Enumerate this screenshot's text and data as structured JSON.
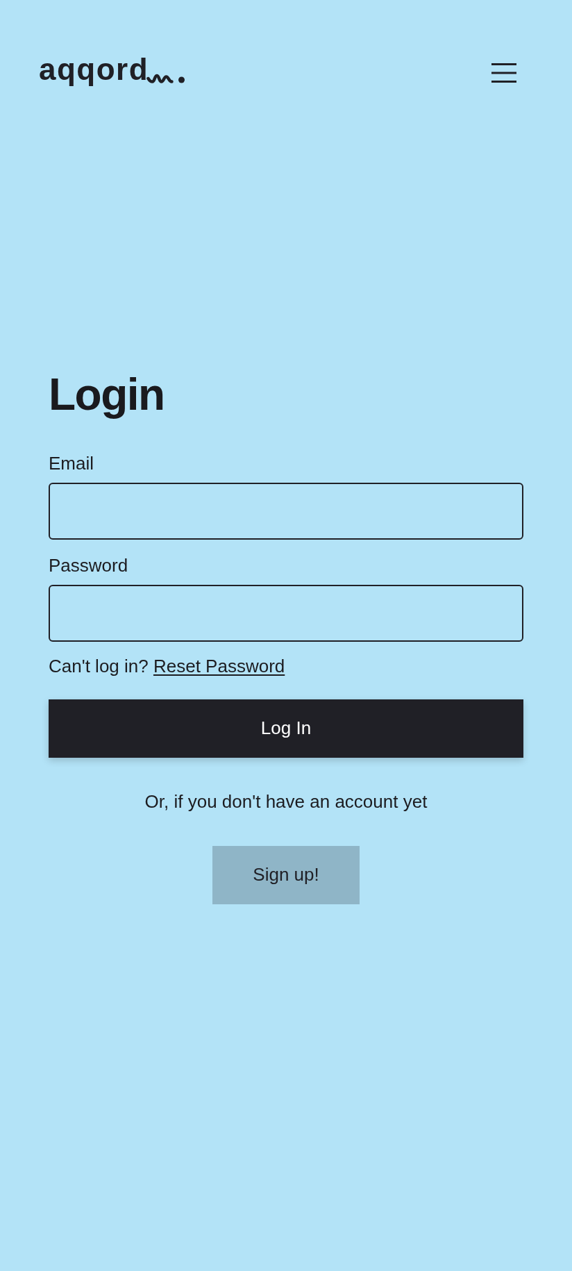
{
  "header": {
    "logo": "aqqord"
  },
  "login_form": {
    "title": "Login",
    "fields": [
      {
        "label": "Email"
      },
      {
        "label": "Password"
      }
    ],
    "help_text": "Can't log in?",
    "help_link": "Reset Password",
    "submit_button": "Log In"
  },
  "signup": {
    "prompt": "Or, if you don't have an account yet",
    "button": "Sign up!"
  }
}
